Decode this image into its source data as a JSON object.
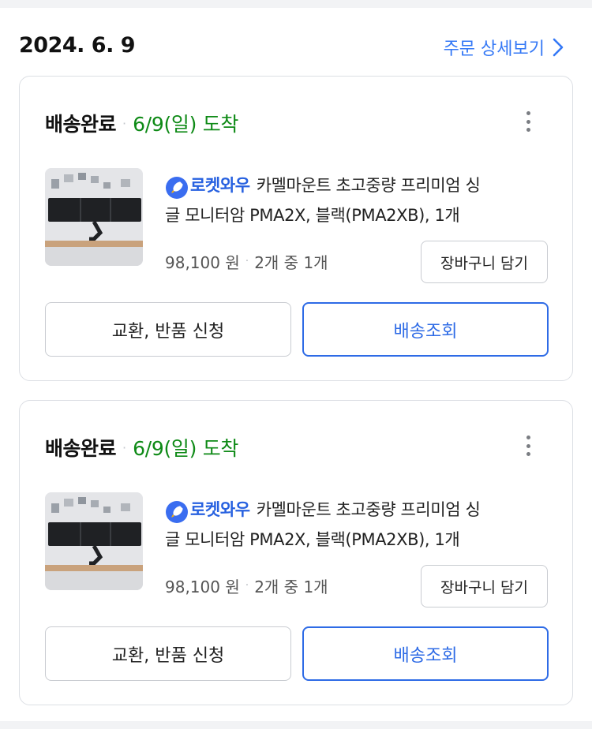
{
  "order": {
    "date": "2024. 6. 9",
    "detail_link": "주문 상세보기"
  },
  "colors": {
    "link": "#3478f6",
    "arrival_green": "#0e8a16",
    "rocket_blue": "#2761e0",
    "primary_border": "#2e6be6"
  },
  "icons": [
    "chevron-right-icon",
    "more-vertical-icon",
    "rocket-icon"
  ],
  "items": [
    {
      "status": "배송완료",
      "separator": "·",
      "arrival": "6/9(일) 도착",
      "badge": "로켓와우",
      "title_line1": "카멜마운트 초고중량 프리미엄 싱",
      "title_line2": "글 모니터암 PMA2X, 블랙(PMA2XB), 1개",
      "price": "98,100 원",
      "quantity": "2개 중 1개",
      "cart_button": "장바구니 담기",
      "exchange_button": "교환, 반품 신청",
      "track_button": "배송조회"
    },
    {
      "status": "배송완료",
      "separator": "·",
      "arrival": "6/9(일) 도착",
      "badge": "로켓와우",
      "title_line1": "카멜마운트 초고중량 프리미엄 싱",
      "title_line2": "글 모니터암 PMA2X, 블랙(PMA2XB), 1개",
      "price": "98,100 원",
      "quantity": "2개 중 1개",
      "cart_button": "장바구니 담기",
      "exchange_button": "교환, 반품 신청",
      "track_button": "배송조회"
    }
  ]
}
